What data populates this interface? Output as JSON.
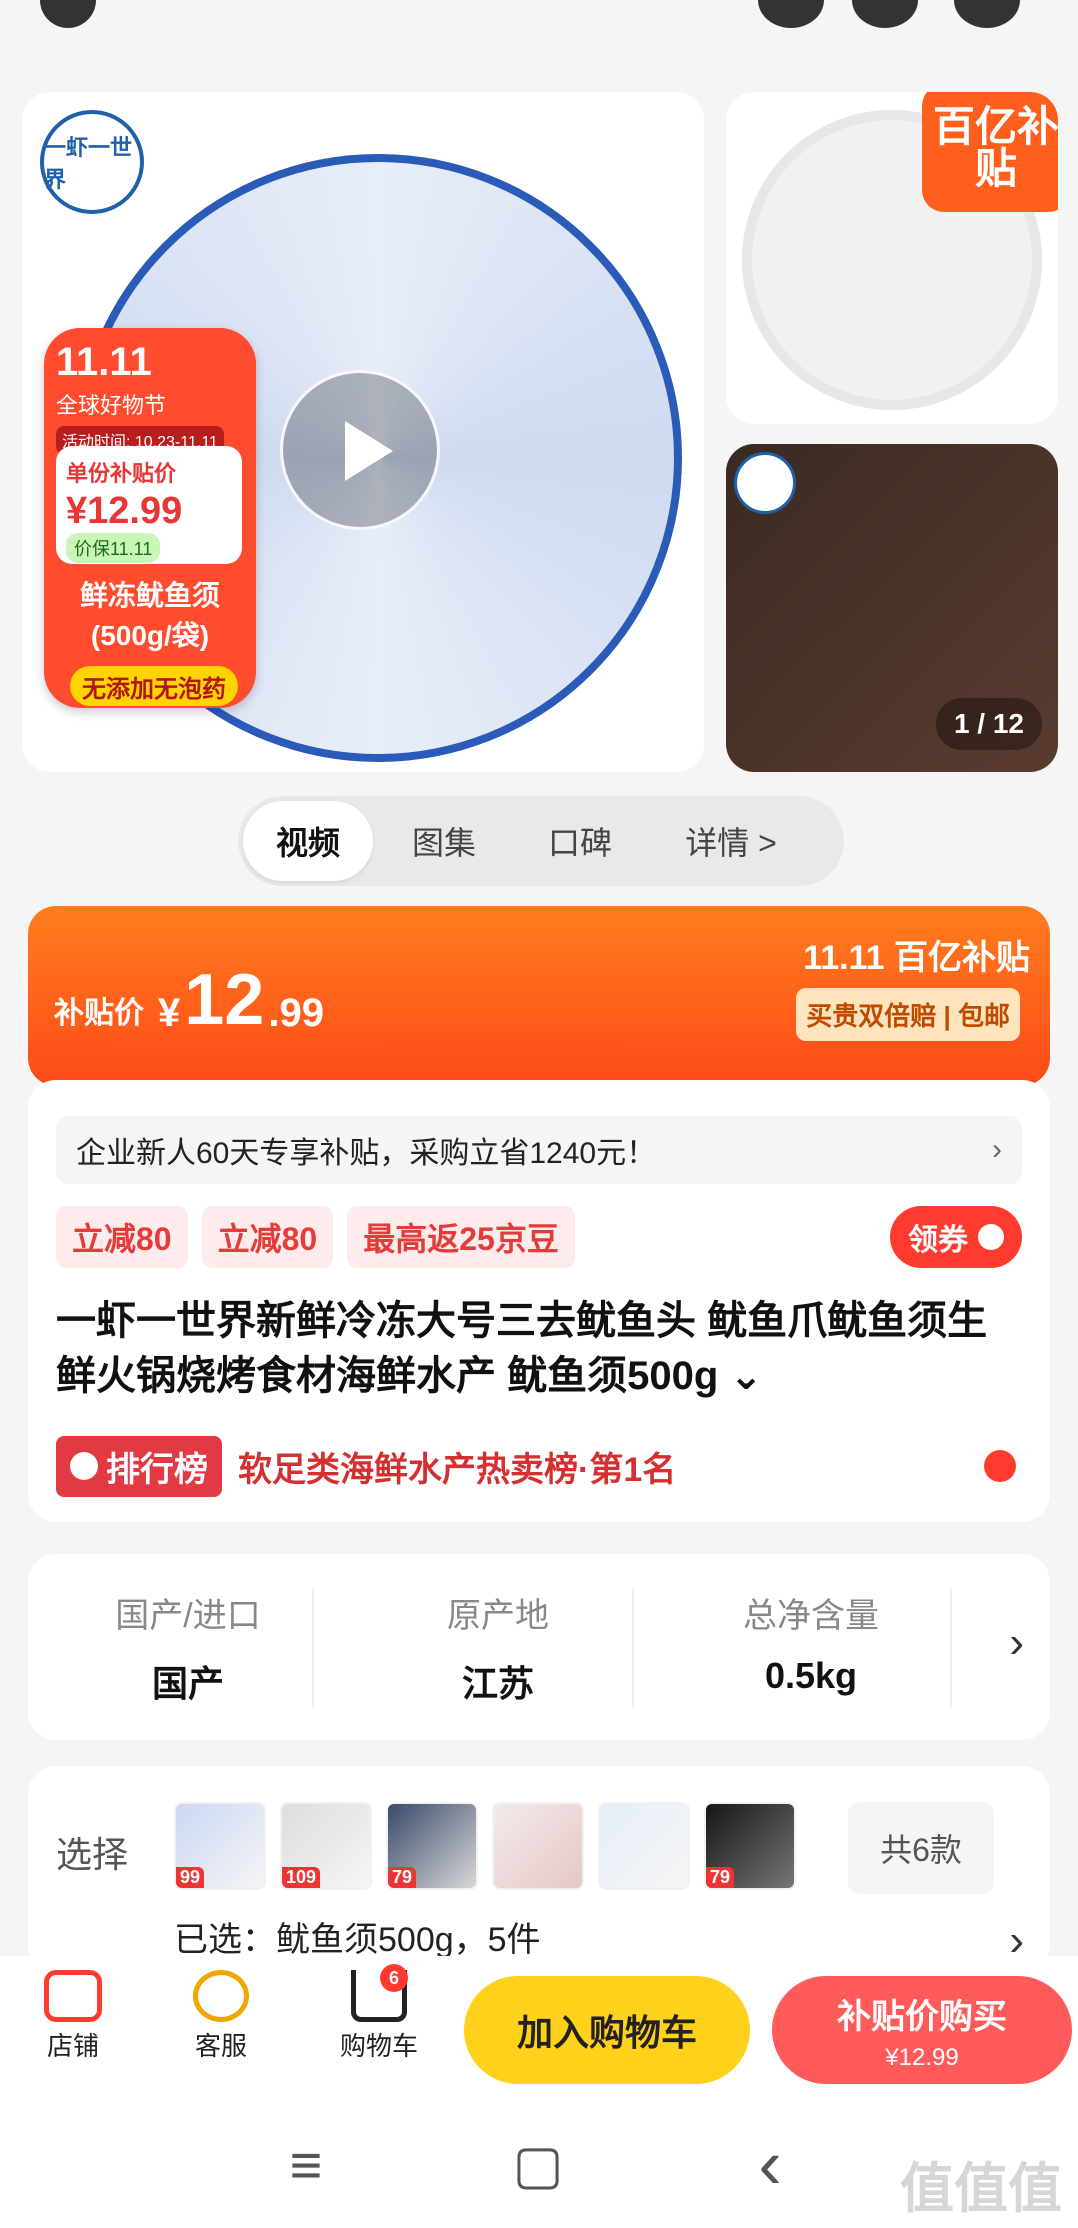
{
  "overlay": {
    "brand_tag": "百亿补贴",
    "video_index": "1 / 12"
  },
  "left_card": {
    "logo_text": "一虾一世界",
    "event_title": "11.11",
    "event_sub": "全球好物节",
    "event_time": "活动时间: 10.23-11.11",
    "unit_price_label": "单份补贴价",
    "unit_price": "¥12.99",
    "guarantee": "价保11.11",
    "product_short": "鲜冻鱿鱼须\n(500g/袋)",
    "no_additive": "无添加无泡药"
  },
  "tabs": [
    {
      "label": "视频",
      "active": true
    },
    {
      "label": "图集",
      "active": false
    },
    {
      "label": "口碑",
      "active": false
    },
    {
      "label": "详情 >",
      "active": false
    }
  ],
  "price_banner": {
    "label": "补贴价",
    "currency": "¥",
    "int": "12",
    "dec": ".99",
    "brand_right": "11.11 百亿补贴",
    "guarantee": "买贵双倍赔 | 包邮"
  },
  "promo_row": {
    "text": "企业新人60天专享补贴，采购立省1240元！",
    "arrow": "›"
  },
  "coupons": [
    "立减80",
    "立减80",
    "最高返25京豆"
  ],
  "coupon_button": "领券",
  "title": "一虾一世界新鲜冷冻大号三去鱿鱼头 鱿鱼爪鱿鱼须生鲜火锅烧烤食材海鲜水产 鱿鱼须500g ⌄",
  "rank": {
    "badge": "排行榜",
    "text": "软足类海鲜水产热卖榜·第1名"
  },
  "specs": {
    "items": [
      {
        "label": "国产/进口",
        "value": "国产"
      },
      {
        "label": "原产地",
        "value": "江苏"
      },
      {
        "label": "总净含量",
        "value": "0.5kg"
      }
    ],
    "arrow": "›"
  },
  "select": {
    "label": "选择",
    "thumbs": [
      "99",
      "109",
      "79",
      "",
      "",
      "79"
    ],
    "count": "共6款",
    "selected": "已选：鱿鱼须500g，5件",
    "arrow": "›"
  },
  "bottom_bar": {
    "store": "店铺",
    "service": "客服",
    "cart": "购物车",
    "cart_count": "6",
    "add_to_cart": "加入购物车",
    "buy": "补贴价购买",
    "buy_price": "¥12.99"
  },
  "system_nav": {
    "menu": "≡",
    "home": "▢",
    "back": "‹"
  },
  "watermark": "值值值"
}
